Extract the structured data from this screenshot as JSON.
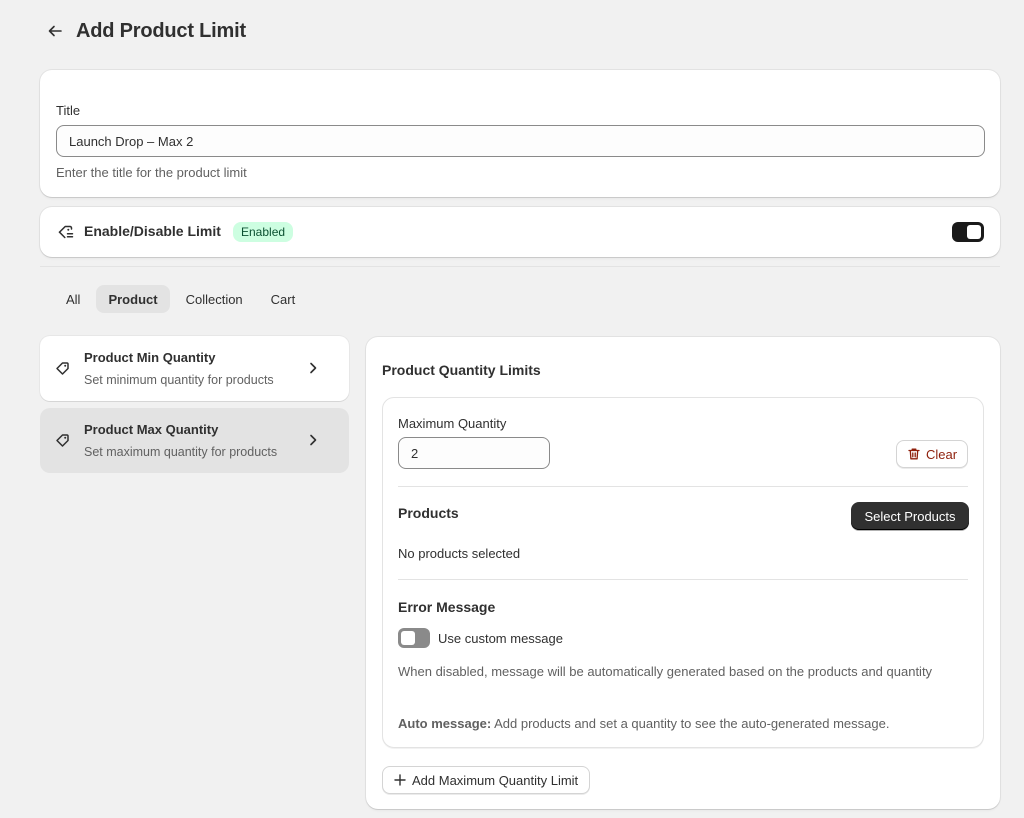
{
  "header": {
    "title": "Add Product Limit",
    "back_icon": "arrow-left-icon"
  },
  "title_section": {
    "label": "Title",
    "value": "Launch Drop – Max 2",
    "help_text": "Enter the title for the product limit"
  },
  "enable_section": {
    "icon": "tag-limit-icon",
    "label": "Enable/Disable Limit",
    "badge": "Enabled",
    "toggle_state": "on"
  },
  "tabs": [
    {
      "label": "All",
      "active": false
    },
    {
      "label": "Product",
      "active": true
    },
    {
      "label": "Collection",
      "active": false
    },
    {
      "label": "Cart",
      "active": false
    }
  ],
  "sidebar": {
    "items": [
      {
        "title": "Product Min Quantity",
        "description": "Set minimum quantity for products",
        "icon": "tag-icon",
        "selected": false
      },
      {
        "title": "Product Max Quantity",
        "description": "Set maximum quantity for products",
        "icon": "tag-icon",
        "selected": true
      }
    ]
  },
  "main": {
    "title": "Product Quantity Limits",
    "max_quantity_label": "Maximum Quantity",
    "max_quantity_value": "2",
    "clear_label": "Clear",
    "products_title": "Products",
    "select_products_label": "Select Products",
    "no_products_text": "No products selected",
    "error_message_title": "Error Message",
    "custom_message_label": "Use custom message",
    "custom_message_toggle": "off",
    "disabled_note": "When disabled, message will be automatically generated based on the products and quantity",
    "auto_message_prefix": "Auto message:",
    "auto_message_text": "Add products and set a quantity to see the auto-generated message.",
    "add_limit_label": "Add Maximum Quantity Limit"
  },
  "colors": {
    "background": "#f1f1f1",
    "badge_bg": "#cdfee1",
    "badge_text": "#0c5132",
    "primary_button": "#303030",
    "critical_text": "#8e1f0b"
  }
}
